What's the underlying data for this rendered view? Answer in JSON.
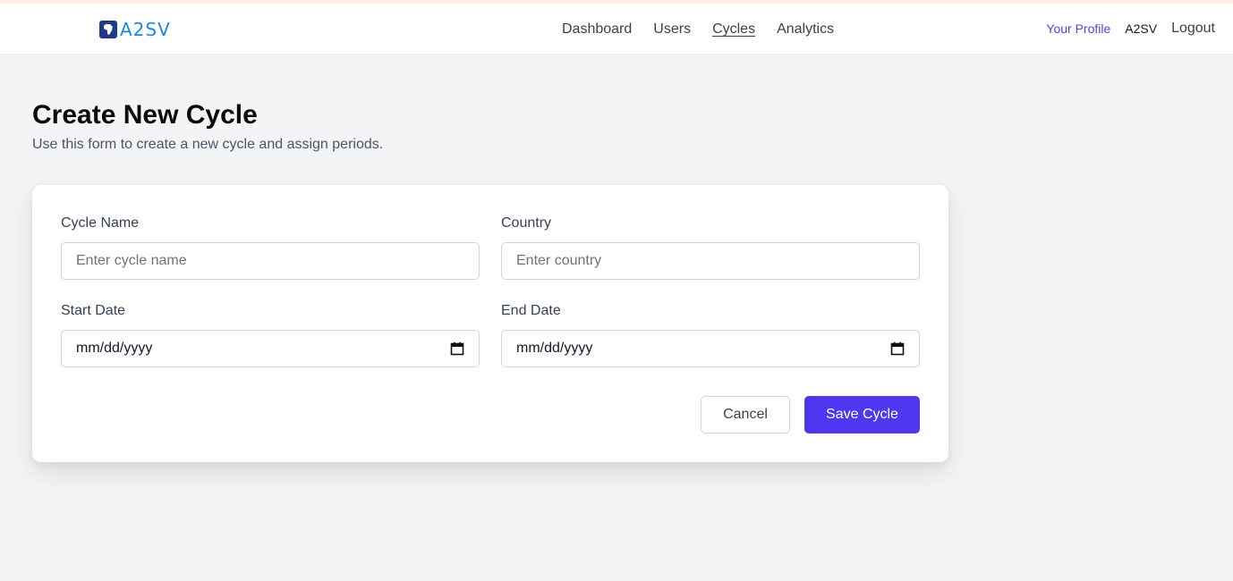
{
  "brand": {
    "logo_text": "A2SV"
  },
  "nav": {
    "items": [
      {
        "label": "Dashboard"
      },
      {
        "label": "Users"
      },
      {
        "label": "Cycles"
      },
      {
        "label": "Analytics"
      }
    ]
  },
  "header_right": {
    "profile_label": "Your Profile",
    "org_name": "A2SV",
    "logout_label": "Logout"
  },
  "page": {
    "title": "Create New Cycle",
    "subtitle": "Use this form to create a new cycle and assign periods."
  },
  "form": {
    "cycle_name": {
      "label": "Cycle Name",
      "placeholder": "Enter cycle name",
      "value": ""
    },
    "country": {
      "label": "Country",
      "placeholder": "Enter country",
      "value": ""
    },
    "start_date": {
      "label": "Start Date",
      "value": "mm/dd/yyyy"
    },
    "end_date": {
      "label": "End Date",
      "value": "mm/dd/yyyy"
    },
    "cancel_label": "Cancel",
    "save_label": "Save Cycle"
  },
  "colors": {
    "accent": "#4f37f0",
    "link": "#4f46e5",
    "logo": "#1e88e5",
    "background": "#f3f4f6"
  }
}
